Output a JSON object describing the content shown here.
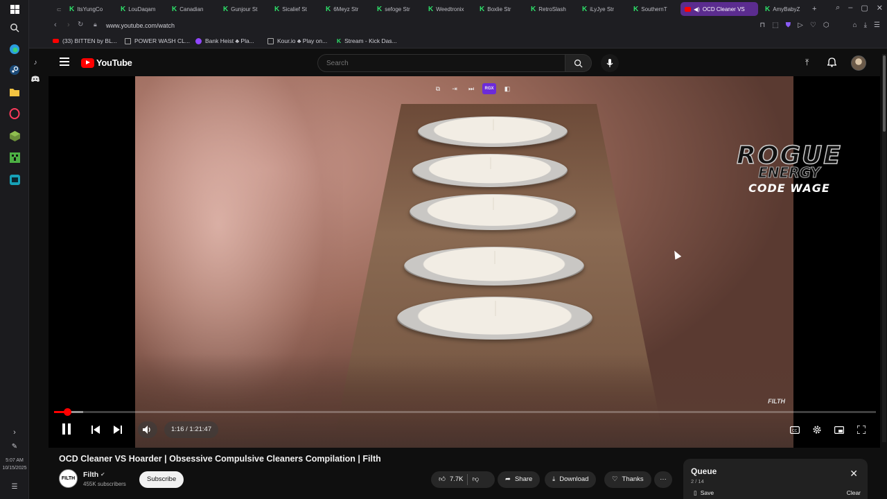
{
  "colors": {
    "brand_red": "#ff0000",
    "opera_accent": "#5b2c8f",
    "kick_green": "#2ee06a"
  },
  "sidebar": {
    "icons": [
      "windows-icon",
      "opera-icon",
      "search-icon",
      "edge-icon",
      "steam-icon",
      "folder-icon",
      "opera-gx-icon",
      "minecraft-icon",
      "creeper-icon",
      "terminal-icon",
      "tiktok-icon",
      "discord-icon",
      "chevron-right-icon",
      "settings-icon"
    ],
    "time": "5:07 AM",
    "date": "10/15/2025"
  },
  "tabs": [
    {
      "label": "ItsYungCo"
    },
    {
      "label": "LouDaqam"
    },
    {
      "label": "Canadian"
    },
    {
      "label": "Gunjour St"
    },
    {
      "label": "Sicalief St"
    },
    {
      "label": "6Meyz Str"
    },
    {
      "label": "sefoge Str"
    },
    {
      "label": "Weedtronix"
    },
    {
      "label": "Boxlie Str"
    },
    {
      "label": "RetroSlash"
    },
    {
      "label": "iLyJye Str"
    },
    {
      "label": "SouthernT"
    },
    {
      "label": "OCD Cleaner VS"
    },
    {
      "label": "AmyBabyZ"
    }
  ],
  "address": {
    "url": "www.youtube.com/watch"
  },
  "bookmarks": [
    {
      "label": "(33) BITTEN by BL..."
    },
    {
      "label": "POWER WASH CL..."
    },
    {
      "label": "Bank Heist ♣ Pla..."
    },
    {
      "label": "Kour.io ♣ Play on..."
    },
    {
      "label": "Stream - Kick Das..."
    }
  ],
  "youtube": {
    "logo_text": "YouTube",
    "search_placeholder": "Search"
  },
  "overlay": {
    "rogue_top": "ROGUE",
    "rogue_mid": "ENERGY",
    "code_wage": "CODE WAGE",
    "watermark": "FILTH",
    "mini_badge": "RGX"
  },
  "player": {
    "time": "1:16 / 1:21:47",
    "progress": 0.016,
    "buffered": 0.035
  },
  "video": {
    "title": "OCD Cleaner VS Hoarder | Obsessive Compulsive Cleaners Compilation | Filth",
    "channel": "Filth",
    "subscribers": "455K subscribers",
    "channel_avatar_text": "FILTH",
    "subscribe_label": "Subscribe",
    "likes": "7.7K",
    "share_label": "Share",
    "download_label": "Download",
    "thanks_label": "Thanks"
  },
  "queue": {
    "title": "Queue",
    "count": "2 / 14",
    "save_label": "Save",
    "clear_label": "Clear"
  }
}
